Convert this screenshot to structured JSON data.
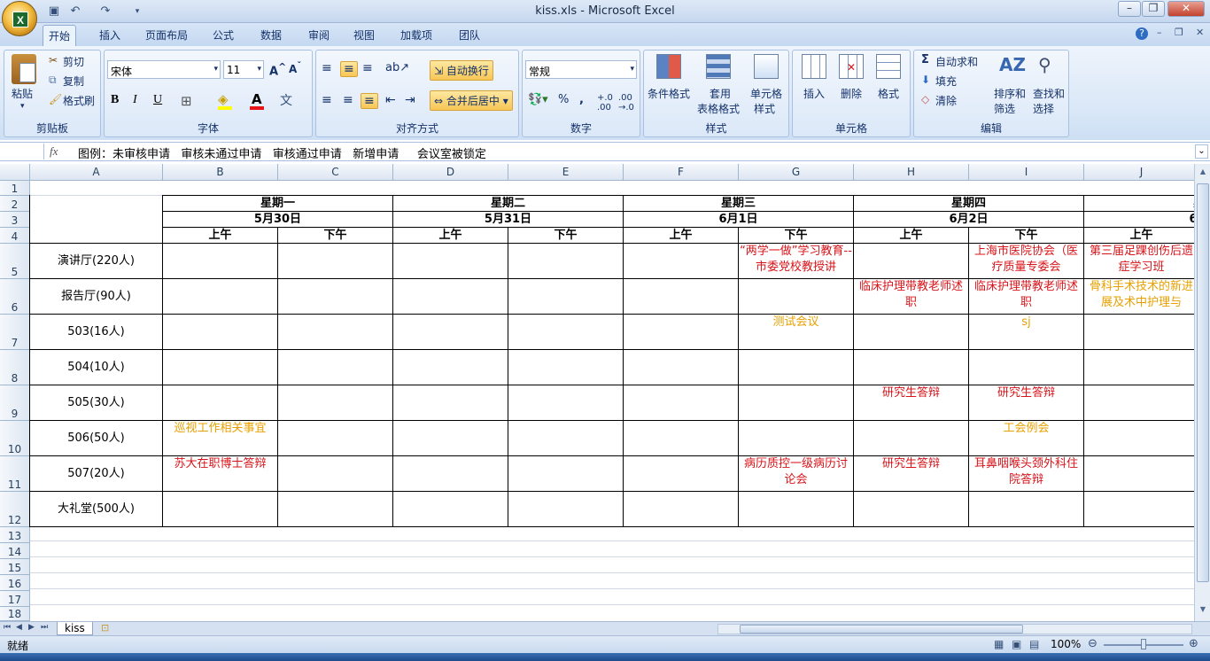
{
  "window": {
    "title": "kiss.xls - Microsoft Excel"
  },
  "tabs": [
    "开始",
    "插入",
    "页面布局",
    "公式",
    "数据",
    "审阅",
    "视图",
    "加载项",
    "团队"
  ],
  "ribbon": {
    "clipboard": {
      "label": "剪贴板",
      "paste": "粘贴",
      "cut": "剪切",
      "copy": "复制",
      "format_painter": "格式刷"
    },
    "font": {
      "label": "字体",
      "name": "宋体",
      "size": "11"
    },
    "alignment": {
      "label": "对齐方式",
      "wrap": "自动换行",
      "merge": "合并后居中"
    },
    "number": {
      "label": "数字",
      "format": "常规"
    },
    "styles": {
      "label": "样式",
      "cond1": "条件格式",
      "table1": "套用",
      "table2": "表格格式",
      "cell1": "单元格",
      "cell2": "样式"
    },
    "cells": {
      "label": "单元格",
      "insert": "插入",
      "delete": "删除",
      "format": "格式"
    },
    "editing": {
      "label": "编辑",
      "autosum": "自动求和",
      "fill": "填充",
      "clear": "清除",
      "sort1": "排序和",
      "sort2": "筛选",
      "find1": "查找和",
      "find2": "选择"
    }
  },
  "formula": {
    "fx": "fx",
    "content": "图例：未审核申请   审核未通过申请   审核通过申请   新增申请     会议室被锁定"
  },
  "columns": [
    "A",
    "B",
    "C",
    "D",
    "E",
    "F",
    "G",
    "H",
    "I",
    "J"
  ],
  "rows": [
    "1",
    "2",
    "3",
    "4",
    "5",
    "6",
    "7",
    "8",
    "9",
    "10",
    "11",
    "12",
    "13",
    "14",
    "15",
    "16",
    "17",
    "18"
  ],
  "schedule": {
    "days": [
      "星期一",
      "星期二",
      "星期三",
      "星期四",
      "星"
    ],
    "dates": [
      "5月30日",
      "5月31日",
      "6月1日",
      "6月2日",
      "6月"
    ],
    "am": "上午",
    "pm": "下午",
    "rooms": [
      "演讲厅(220人)",
      "报告厅(90人)",
      "503(16人)",
      "504(10人)",
      "505(30人)",
      "506(50人)",
      "507(20人)",
      "大礼堂(500人)"
    ],
    "events": {
      "g5": "“两学一做”学习教育--市委党校教授讲",
      "i5": "上海市医院协会（医疗质量专委会",
      "j5": "第三届足踝创伤后遗症学习班",
      "h6": "临床护理带教老师述职",
      "i6": "临床护理带教老师述职",
      "j6": "骨科手术技术的新进展及术中护理与",
      "g7": "测试会议",
      "i7": "sj",
      "h9": "研究生答辩",
      "i9": "研究生答辩",
      "b10": "巡视工作相关事宜",
      "i10": "工会例会",
      "b11": "苏大在职博士答辩",
      "g11": "病历质控一级病历讨论会",
      "h11": "研究生答辩",
      "i11": "耳鼻咽喉头颈外科住院答辩"
    }
  },
  "sheet": {
    "tab": "kiss"
  },
  "status": {
    "ready": "就绪",
    "zoom": "100%"
  }
}
